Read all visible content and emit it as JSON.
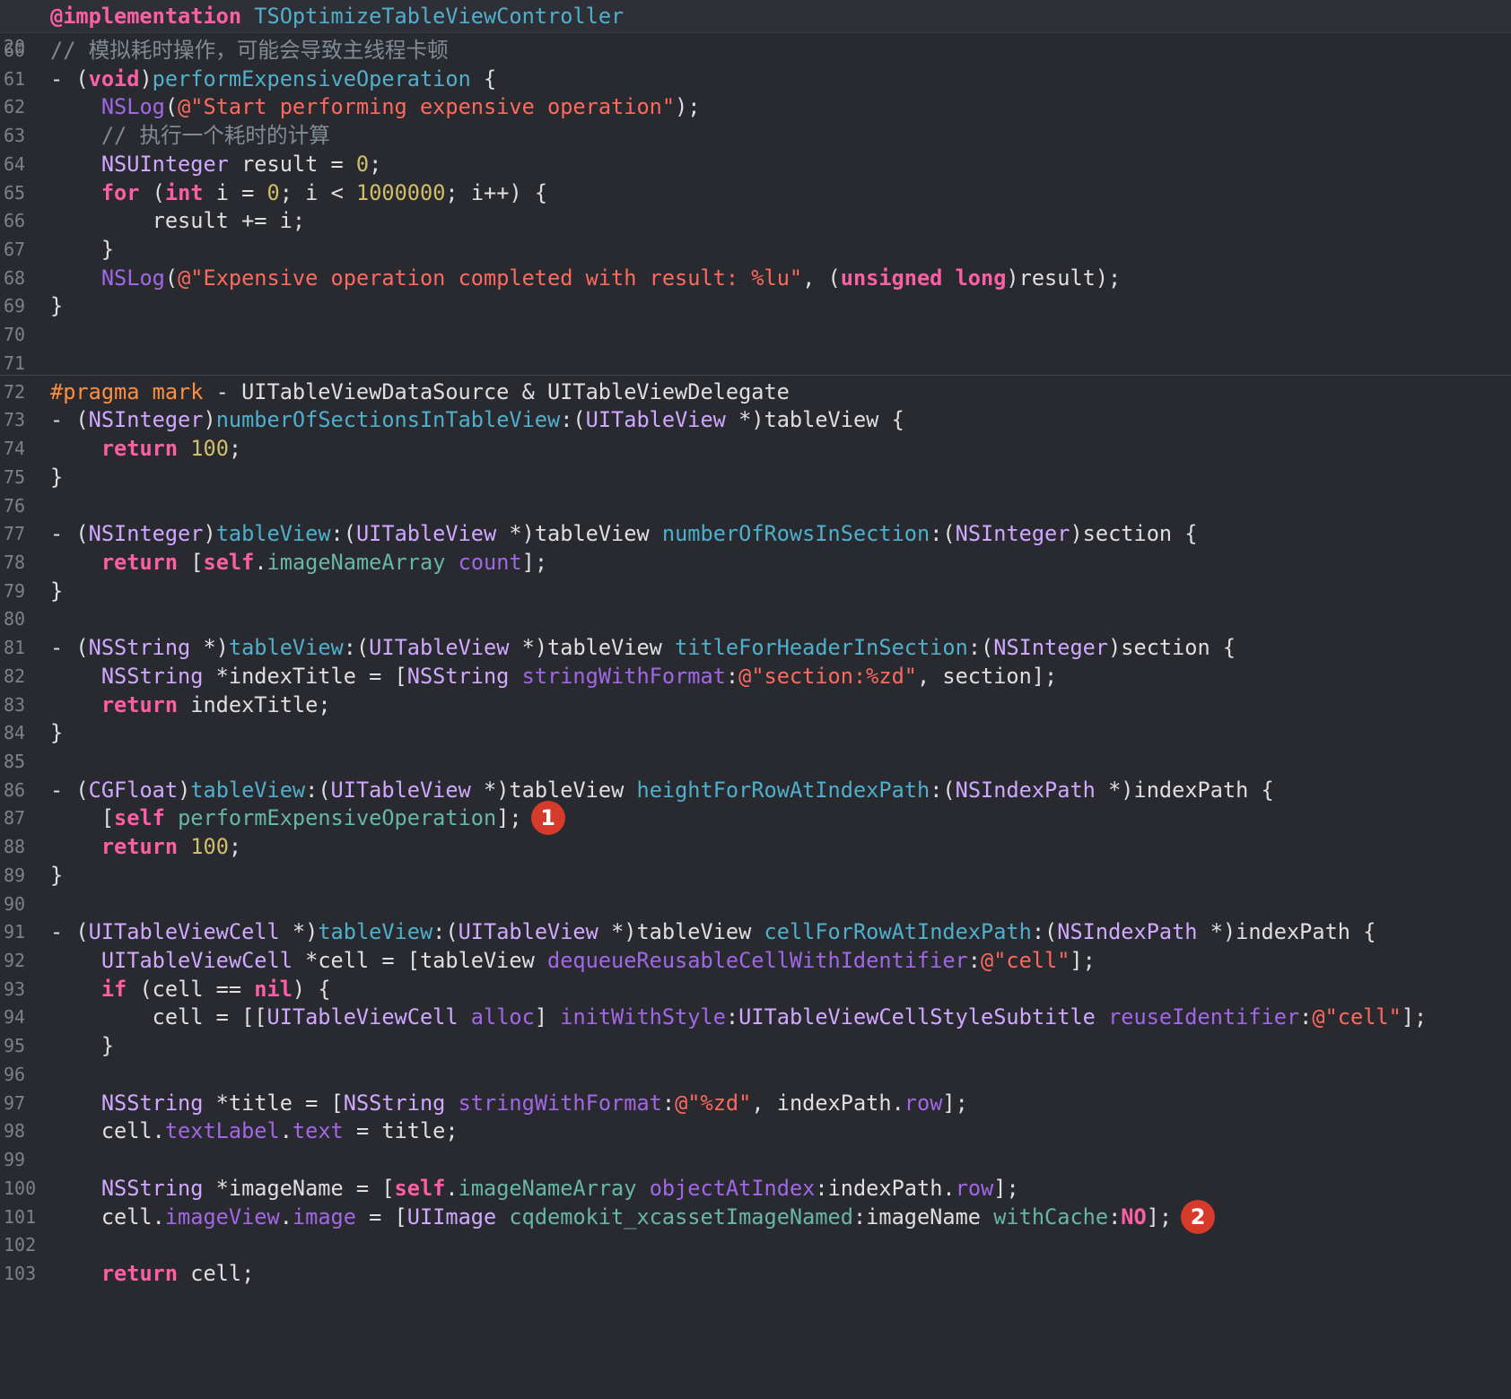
{
  "header": {
    "line_number": "20",
    "keyword": "@implementation",
    "class_name": "TSOptimizeTableViewController"
  },
  "lines": [
    {
      "n": "60",
      "tokens": [
        [
          "cmt",
          "// 模拟耗时操作，可能会导致主线程卡顿"
        ]
      ]
    },
    {
      "n": "61",
      "tokens": [
        [
          "",
          "- ("
        ],
        [
          "kw",
          "void"
        ],
        [
          "",
          ")"
        ],
        [
          "me",
          "performExpensiveOperation"
        ],
        [
          "",
          " {"
        ]
      ]
    },
    {
      "n": "62",
      "tokens": [
        [
          "",
          "    "
        ],
        [
          "pr",
          "NSLog"
        ],
        [
          "",
          "("
        ],
        [
          "str",
          "@\"Start performing expensive operation\""
        ],
        [
          "",
          ");"
        ]
      ]
    },
    {
      "n": "63",
      "tokens": [
        [
          "",
          "    "
        ],
        [
          "cmt",
          "// 执行一个耗时的计算"
        ]
      ]
    },
    {
      "n": "64",
      "tokens": [
        [
          "",
          "    "
        ],
        [
          "ty",
          "NSUInteger"
        ],
        [
          "",
          " result = "
        ],
        [
          "num",
          "0"
        ],
        [
          "",
          ";"
        ]
      ]
    },
    {
      "n": "65",
      "tokens": [
        [
          "",
          "    "
        ],
        [
          "kw",
          "for"
        ],
        [
          "",
          " ("
        ],
        [
          "kw",
          "int"
        ],
        [
          "",
          " i = "
        ],
        [
          "num",
          "0"
        ],
        [
          "",
          "; i < "
        ],
        [
          "num",
          "1000000"
        ],
        [
          "",
          "; i++) {"
        ]
      ]
    },
    {
      "n": "66",
      "tokens": [
        [
          "",
          "        result += i;"
        ]
      ]
    },
    {
      "n": "67",
      "tokens": [
        [
          "",
          "    }"
        ]
      ]
    },
    {
      "n": "68",
      "tokens": [
        [
          "",
          "    "
        ],
        [
          "pr",
          "NSLog"
        ],
        [
          "",
          "("
        ],
        [
          "str",
          "@\"Expensive operation completed with result: %lu\""
        ],
        [
          "",
          ", ("
        ],
        [
          "kw",
          "unsigned"
        ],
        [
          "",
          " "
        ],
        [
          "kw",
          "long"
        ],
        [
          "",
          ")result);"
        ]
      ]
    },
    {
      "n": "69",
      "tokens": [
        [
          "",
          "}"
        ]
      ]
    },
    {
      "n": "70",
      "tokens": []
    },
    {
      "n": "71",
      "tokens": []
    },
    {
      "n": "72",
      "tokens": [
        [
          "pre",
          "#pragma mark"
        ],
        [
          "",
          " - UITableViewDataSource & UITableViewDelegate"
        ]
      ]
    },
    {
      "n": "73",
      "tokens": [
        [
          "",
          "- ("
        ],
        [
          "ty",
          "NSInteger"
        ],
        [
          "",
          ")"
        ],
        [
          "me",
          "numberOfSectionsInTableView"
        ],
        [
          "",
          ":("
        ],
        [
          "ty",
          "UITableView"
        ],
        [
          "",
          " *)tableView {"
        ]
      ]
    },
    {
      "n": "74",
      "tokens": [
        [
          "",
          "    "
        ],
        [
          "kw",
          "return"
        ],
        [
          "",
          " "
        ],
        [
          "num",
          "100"
        ],
        [
          "",
          ";"
        ]
      ]
    },
    {
      "n": "75",
      "tokens": [
        [
          "",
          "}"
        ]
      ]
    },
    {
      "n": "76",
      "tokens": []
    },
    {
      "n": "77",
      "tokens": [
        [
          "",
          "- ("
        ],
        [
          "ty",
          "NSInteger"
        ],
        [
          "",
          ")"
        ],
        [
          "me",
          "tableView"
        ],
        [
          "",
          ":("
        ],
        [
          "ty",
          "UITableView"
        ],
        [
          "",
          " *)tableView "
        ],
        [
          "me",
          "numberOfRowsInSection"
        ],
        [
          "",
          ":("
        ],
        [
          "ty",
          "NSInteger"
        ],
        [
          "",
          ")section {"
        ]
      ]
    },
    {
      "n": "78",
      "tokens": [
        [
          "",
          "    "
        ],
        [
          "kw",
          "return"
        ],
        [
          "",
          " ["
        ],
        [
          "self",
          "self"
        ],
        [
          "",
          "."
        ],
        [
          "fn",
          "imageNameArray"
        ],
        [
          "",
          " "
        ],
        [
          "pr",
          "count"
        ],
        [
          "",
          "];"
        ]
      ]
    },
    {
      "n": "79",
      "tokens": [
        [
          "",
          "}"
        ]
      ]
    },
    {
      "n": "80",
      "tokens": []
    },
    {
      "n": "81",
      "tokens": [
        [
          "",
          "- ("
        ],
        [
          "ty",
          "NSString"
        ],
        [
          "",
          " *)"
        ],
        [
          "me",
          "tableView"
        ],
        [
          "",
          ":("
        ],
        [
          "ty",
          "UITableView"
        ],
        [
          "",
          " *)tableView "
        ],
        [
          "me",
          "titleForHeaderInSection"
        ],
        [
          "",
          ":("
        ],
        [
          "ty",
          "NSInteger"
        ],
        [
          "",
          ")section {"
        ]
      ]
    },
    {
      "n": "82",
      "tokens": [
        [
          "",
          "    "
        ],
        [
          "ty",
          "NSString"
        ],
        [
          "",
          " *indexTitle = ["
        ],
        [
          "ty",
          "NSString"
        ],
        [
          "",
          " "
        ],
        [
          "pr",
          "stringWithFormat"
        ],
        [
          "",
          ":"
        ],
        [
          "str",
          "@\"section:%zd\""
        ],
        [
          "",
          ", section];"
        ]
      ]
    },
    {
      "n": "83",
      "tokens": [
        [
          "",
          "    "
        ],
        [
          "kw",
          "return"
        ],
        [
          "",
          " indexTitle;"
        ]
      ]
    },
    {
      "n": "84",
      "tokens": [
        [
          "",
          "}"
        ]
      ]
    },
    {
      "n": "85",
      "tokens": []
    },
    {
      "n": "86",
      "tokens": [
        [
          "",
          "- ("
        ],
        [
          "ty",
          "CGFloat"
        ],
        [
          "",
          ")"
        ],
        [
          "me",
          "tableView"
        ],
        [
          "",
          ":("
        ],
        [
          "ty",
          "UITableView"
        ],
        [
          "",
          " *)tableView "
        ],
        [
          "me",
          "heightForRowAtIndexPath"
        ],
        [
          "",
          ":("
        ],
        [
          "ty",
          "NSIndexPath"
        ],
        [
          "",
          " *)indexPath {"
        ]
      ]
    },
    {
      "n": "87",
      "tokens": [
        [
          "",
          "    ["
        ],
        [
          "self",
          "self"
        ],
        [
          "",
          " "
        ],
        [
          "fn",
          "performExpensiveOperation"
        ],
        [
          "",
          "];"
        ]
      ],
      "badge": "1"
    },
    {
      "n": "88",
      "tokens": [
        [
          "",
          "    "
        ],
        [
          "kw",
          "return"
        ],
        [
          "",
          " "
        ],
        [
          "num",
          "100"
        ],
        [
          "",
          ";"
        ]
      ]
    },
    {
      "n": "89",
      "tokens": [
        [
          "",
          "}"
        ]
      ]
    },
    {
      "n": "90",
      "tokens": []
    },
    {
      "n": "91",
      "tokens": [
        [
          "",
          "- ("
        ],
        [
          "ty",
          "UITableViewCell"
        ],
        [
          "",
          " *)"
        ],
        [
          "me",
          "tableView"
        ],
        [
          "",
          ":("
        ],
        [
          "ty",
          "UITableView"
        ],
        [
          "",
          " *)tableView "
        ],
        [
          "me",
          "cellForRowAtIndexPath"
        ],
        [
          "",
          ":("
        ],
        [
          "ty",
          "NSIndexPath"
        ],
        [
          "",
          " *)indexPath {"
        ]
      ]
    },
    {
      "n": "92",
      "tokens": [
        [
          "",
          "    "
        ],
        [
          "ty",
          "UITableViewCell"
        ],
        [
          "",
          " *cell = [tableView "
        ],
        [
          "pr",
          "dequeueReusableCellWithIdentifier"
        ],
        [
          "",
          ":"
        ],
        [
          "str",
          "@\"cell\""
        ],
        [
          "",
          "];"
        ]
      ]
    },
    {
      "n": "93",
      "tokens": [
        [
          "",
          "    "
        ],
        [
          "kw",
          "if"
        ],
        [
          "",
          " (cell == "
        ],
        [
          "kw",
          "nil"
        ],
        [
          "",
          ") {"
        ]
      ]
    },
    {
      "n": "94",
      "tokens": [
        [
          "",
          "        cell = [["
        ],
        [
          "ty",
          "UITableViewCell"
        ],
        [
          "",
          " "
        ],
        [
          "pr",
          "alloc"
        ],
        [
          "",
          "] "
        ],
        [
          "pr",
          "initWithStyle"
        ],
        [
          "",
          ":"
        ],
        [
          "ty",
          "UITableViewCellStyleSubtitle"
        ],
        [
          "",
          " "
        ],
        [
          "pr",
          "reuseIdentifier"
        ],
        [
          "",
          ":"
        ],
        [
          "str",
          "@\"cell\""
        ],
        [
          "",
          "];"
        ]
      ]
    },
    {
      "n": "95",
      "tokens": [
        [
          "",
          "    }"
        ]
      ]
    },
    {
      "n": "96",
      "tokens": []
    },
    {
      "n": "97",
      "tokens": [
        [
          "",
          "    "
        ],
        [
          "ty",
          "NSString"
        ],
        [
          "",
          " *title = ["
        ],
        [
          "ty",
          "NSString"
        ],
        [
          "",
          " "
        ],
        [
          "pr",
          "stringWithFormat"
        ],
        [
          "",
          ":"
        ],
        [
          "str",
          "@\"%zd\""
        ],
        [
          "",
          ", indexPath."
        ],
        [
          "pr",
          "row"
        ],
        [
          "",
          "];"
        ]
      ]
    },
    {
      "n": "98",
      "tokens": [
        [
          "",
          "    cell."
        ],
        [
          "pr",
          "textLabel"
        ],
        [
          "",
          "."
        ],
        [
          "pr",
          "text"
        ],
        [
          "",
          " = title;"
        ]
      ]
    },
    {
      "n": "99",
      "tokens": []
    },
    {
      "n": "100",
      "tokens": [
        [
          "",
          "    "
        ],
        [
          "ty",
          "NSString"
        ],
        [
          "",
          " *imageName = ["
        ],
        [
          "self",
          "self"
        ],
        [
          "",
          "."
        ],
        [
          "fn",
          "imageNameArray"
        ],
        [
          "",
          " "
        ],
        [
          "pr",
          "objectAtIndex"
        ],
        [
          "",
          ":indexPath."
        ],
        [
          "pr",
          "row"
        ],
        [
          "",
          "];"
        ]
      ]
    },
    {
      "n": "101",
      "tokens": [
        [
          "",
          "    cell."
        ],
        [
          "pr",
          "imageView"
        ],
        [
          "",
          "."
        ],
        [
          "pr",
          "image"
        ],
        [
          "",
          " = ["
        ],
        [
          "ty",
          "UIImage"
        ],
        [
          "",
          " "
        ],
        [
          "fn",
          "cqdemokit_xcassetImageNamed"
        ],
        [
          "",
          ":imageName "
        ],
        [
          "fn",
          "withCache"
        ],
        [
          "",
          ":"
        ],
        [
          "kw",
          "NO"
        ],
        [
          "",
          "];"
        ]
      ],
      "badge": "2"
    },
    {
      "n": "102",
      "tokens": []
    },
    {
      "n": "103",
      "tokens": [
        [
          "",
          "    "
        ],
        [
          "kw",
          "return"
        ],
        [
          "",
          " cell;"
        ]
      ]
    }
  ],
  "colors": {
    "background": "#292a30",
    "keyword": "#fc5fa3",
    "string": "#fc6a5d",
    "number": "#d0bf69",
    "comment": "#7f8c98",
    "badge": "#d63a2a"
  }
}
